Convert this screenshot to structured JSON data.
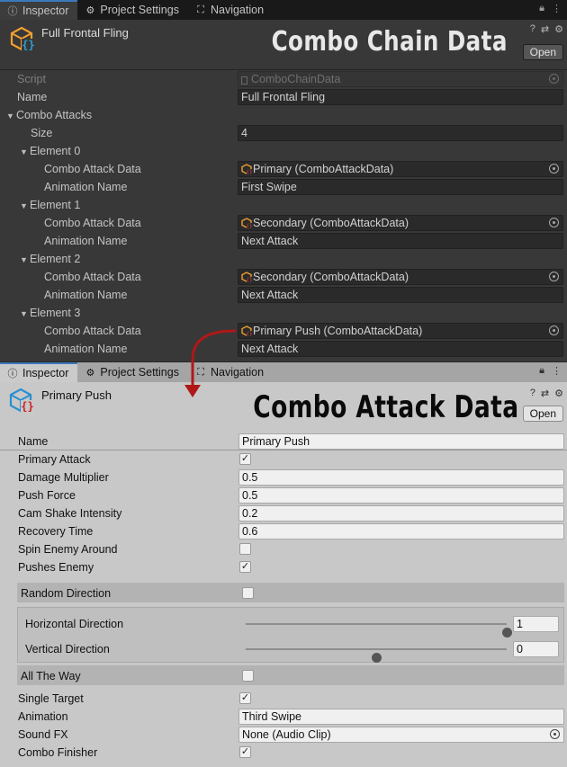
{
  "top_panel": {
    "tabs": [
      {
        "label": "Inspector",
        "icon": "info-icon"
      },
      {
        "label": "Project Settings",
        "icon": "gear-icon"
      },
      {
        "label": "Navigation",
        "icon": "navigation-icon"
      }
    ],
    "asset_name": "Full Frontal Fling",
    "overlay_title": "Combo Chain Data",
    "open_label": "Open",
    "script": {
      "label": "Script",
      "value": "ComboChainData"
    },
    "name": {
      "label": "Name",
      "value": "Full Frontal Fling"
    },
    "combo_attacks": {
      "label": "Combo Attacks",
      "size_label": "Size",
      "size_value": "4",
      "attack_data_label": "Combo Attack Data",
      "animation_label": "Animation Name",
      "elements": [
        {
          "label": "Element 0",
          "attack_data": "Primary (ComboAttackData)",
          "animation": "First Swipe"
        },
        {
          "label": "Element 1",
          "attack_data": "Secondary (ComboAttackData)",
          "animation": "Next Attack"
        },
        {
          "label": "Element 2",
          "attack_data": "Secondary (ComboAttackData)",
          "animation": "Next Attack"
        },
        {
          "label": "Element 3",
          "attack_data": "Primary Push (ComboAttackData)",
          "animation": "Next Attack"
        }
      ]
    }
  },
  "bottom_panel": {
    "tabs": [
      {
        "label": "Inspector",
        "icon": "info-icon"
      },
      {
        "label": "Project Settings",
        "icon": "gear-icon"
      },
      {
        "label": "Navigation",
        "icon": "navigation-icon"
      }
    ],
    "asset_name": "Primary Push",
    "overlay_title": "Combo Attack Data",
    "open_label": "Open",
    "fields": {
      "name": {
        "label": "Name",
        "value": "Primary Push"
      },
      "primary_attack": {
        "label": "Primary Attack",
        "checked": true
      },
      "damage_multiplier": {
        "label": "Damage Multiplier",
        "value": "0.5"
      },
      "push_force": {
        "label": "Push Force",
        "value": "0.5"
      },
      "cam_shake": {
        "label": "Cam Shake Intensity",
        "value": "0.2"
      },
      "recovery_time": {
        "label": "Recovery Time",
        "value": "0.6"
      },
      "spin_enemy": {
        "label": "Spin Enemy Around",
        "checked": false
      },
      "pushes_enemy": {
        "label": "Pushes Enemy",
        "checked": true
      },
      "random_direction": {
        "label": "Random Direction",
        "checked": false
      },
      "horizontal_direction": {
        "label": "Horizontal Direction",
        "value": "1",
        "min": 0,
        "max": 1,
        "level": 1.0
      },
      "vertical_direction": {
        "label": "Vertical Direction",
        "value": "0",
        "min": -1,
        "max": 1,
        "level": 0.5
      },
      "all_the_way": {
        "label": "All The Way",
        "checked": false
      },
      "single_target": {
        "label": "Single Target",
        "checked": true
      },
      "animation": {
        "label": "Animation",
        "value": "Third Swipe"
      },
      "sound_fx": {
        "label": "Sound FX",
        "value": "None (Audio Clip)"
      },
      "combo_finisher": {
        "label": "Combo Finisher",
        "checked": true
      }
    }
  },
  "check_glyph": "✓",
  "colors": {
    "accent": "#3a79bb",
    "connector_arrow": "#b01818",
    "script_icon": "#f0a030",
    "attack_icon": "#2aa0d8"
  }
}
